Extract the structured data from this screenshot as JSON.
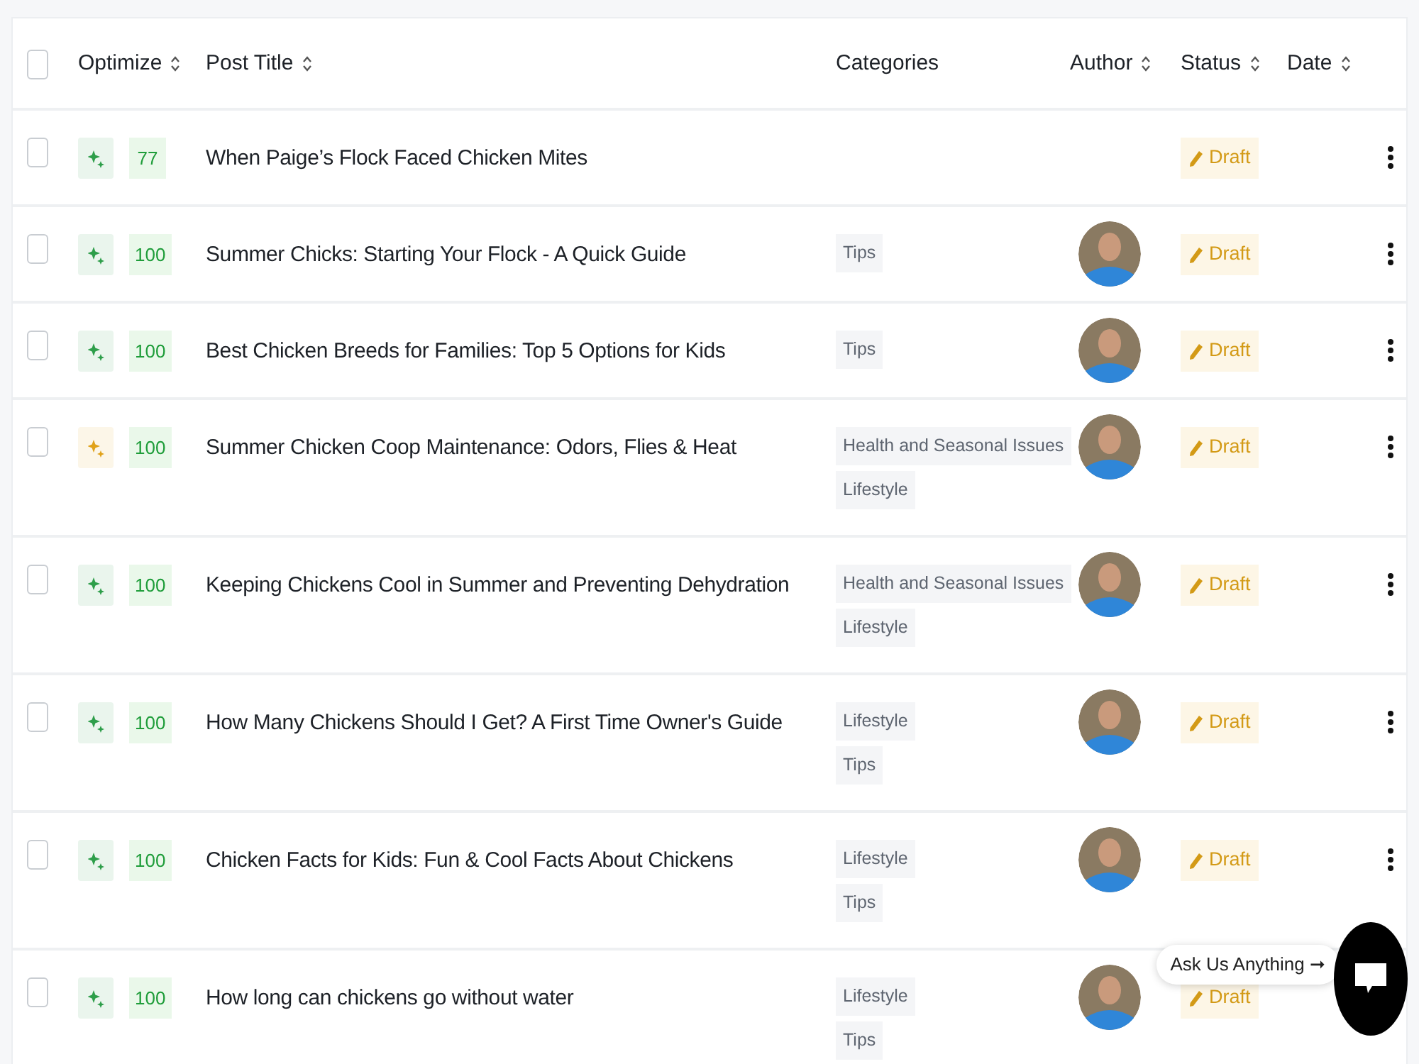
{
  "table": {
    "select_all_checked": false,
    "columns": [
      {
        "label": "Optimize",
        "sortable": true
      },
      {
        "label": "Post Title",
        "sortable": true
      },
      {
        "label": "Categories",
        "sortable": false
      },
      {
        "label": "Author",
        "sortable": true
      },
      {
        "label": "Status",
        "sortable": true
      },
      {
        "label": "Date",
        "sortable": true
      }
    ],
    "rows": [
      {
        "checked": false,
        "color": "#2e9e4a",
        "score": "77",
        "title": "When Paige’s Flock Faced Chicken Mites",
        "categories": [],
        "has_avatar": false,
        "status": "Draft"
      },
      {
        "checked": false,
        "color": "#2e9e4a",
        "score": "100",
        "title": "Summer Chicks: Starting Your Flock - A Quick Guide",
        "categories": [
          "Tips"
        ],
        "has_avatar": true,
        "status": "Draft"
      },
      {
        "checked": false,
        "color": "#2e9e4a",
        "score": "100",
        "title": "Best Chicken Breeds for Families: Top 5 Options for Kids",
        "categories": [
          "Tips"
        ],
        "has_avatar": true,
        "status": "Draft"
      },
      {
        "checked": false,
        "color": "#e0a21a",
        "score": "100",
        "title": "Summer Chicken Coop Maintenance: Odors, Flies & Heat",
        "categories": [
          "Health and Seasonal Issues",
          "Lifestyle"
        ],
        "has_avatar": true,
        "status": "Draft"
      },
      {
        "checked": false,
        "color": "#2e9e4a",
        "score": "100",
        "title": "Keeping Chickens Cool in Summer and Preventing Dehydration",
        "categories": [
          "Health and Seasonal Issues",
          "Lifestyle"
        ],
        "has_avatar": true,
        "status": "Draft"
      },
      {
        "checked": false,
        "color": "#2e9e4a",
        "score": "100",
        "title": "How Many Chickens Should I Get? A First Time Owner's Guide",
        "categories": [
          "Lifestyle",
          "Tips"
        ],
        "has_avatar": true,
        "status": "Draft"
      },
      {
        "checked": false,
        "color": "#2e9e4a",
        "score": "100",
        "title": "Chicken Facts for Kids: Fun & Cool Facts About Chickens",
        "categories": [
          "Lifestyle",
          "Tips"
        ],
        "has_avatar": true,
        "status": "Draft"
      },
      {
        "checked": false,
        "color": "#2e9e4a",
        "score": "100",
        "title": "How long can chickens go without water",
        "categories": [
          "Lifestyle",
          "Tips"
        ],
        "has_avatar": true,
        "status": "Draft"
      }
    ]
  },
  "chat_widget": {
    "label": "Ask Us Anything ➞"
  }
}
